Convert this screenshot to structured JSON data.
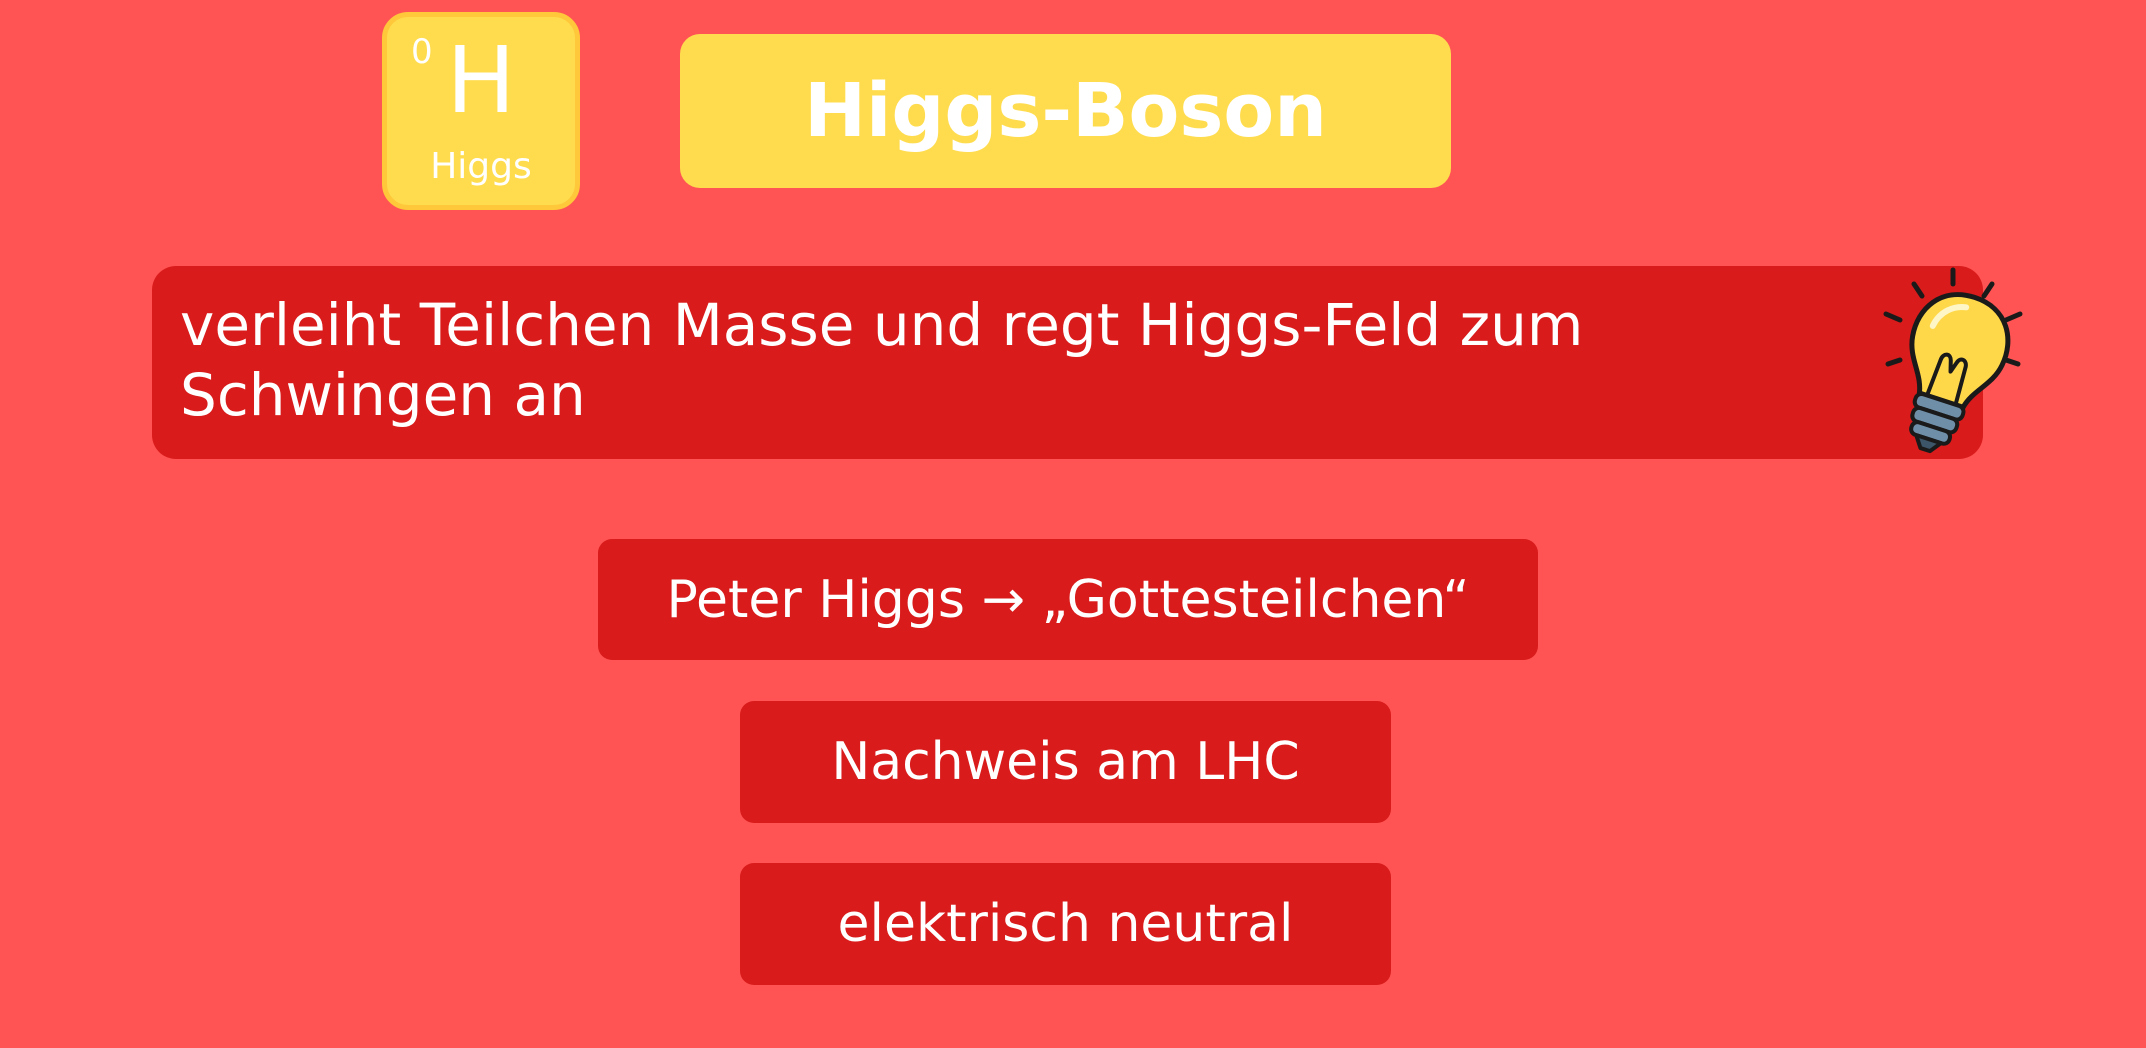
{
  "particle_tile": {
    "charge": "0",
    "symbol": "H",
    "name": "Higgs"
  },
  "title": "Higgs-Boson",
  "definition": "verleiht Teilchen Masse und regt Higgs-Feld zum Schwingen an",
  "icon": "lightbulb-icon",
  "facts": [
    "Peter Higgs → „Gottesteilchen“",
    "Nachweis am LHC",
    "elektrisch neutral"
  ],
  "colors": {
    "background": "#ff5453",
    "box_red": "#d91b1b",
    "accent_yellow": "#ffdc4e"
  }
}
